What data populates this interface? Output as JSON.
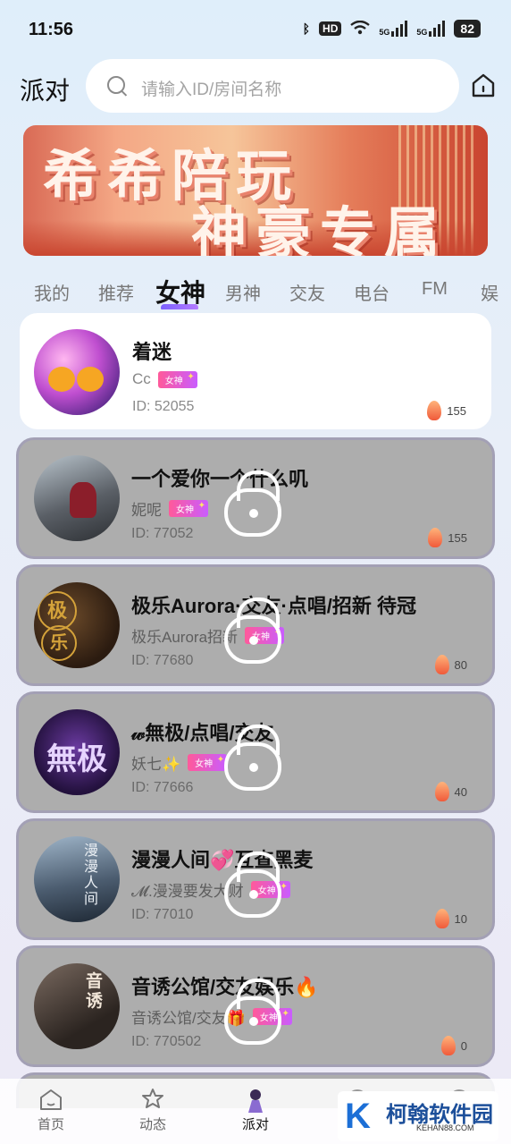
{
  "status": {
    "time": "11:56",
    "hd": "HD",
    "net1": "5G",
    "net2": "5G",
    "battery": "82"
  },
  "header": {
    "title": "派对",
    "search_placeholder": "请输入ID/房间名称"
  },
  "banner": {
    "line1": "希希陪玩",
    "line2": "神豪专属"
  },
  "tabs": [
    "我的",
    "推荐",
    "女神",
    "男神",
    "交友",
    "电台",
    "FM",
    "娱"
  ],
  "active_tab": "女神",
  "rooms": [
    {
      "name": "着迷",
      "host": "Cc",
      "badge": "女神",
      "id": "ID: 52055",
      "heat": "155",
      "locked": false
    },
    {
      "name": "一个爱你一个什么叽",
      "host": "妮呢",
      "badge": "女神",
      "id": "ID: 77052",
      "heat": "155",
      "locked": true
    },
    {
      "name": "极乐Aurora·交友·点唱/招新 待冠",
      "host": "极乐Aurora招新",
      "badge": "女神",
      "id": "ID: 77680",
      "heat": "80",
      "locked": true
    },
    {
      "name": "𝓌無极/点唱/交友",
      "host": "妖七✨",
      "badge": "女神",
      "id": "ID: 77666",
      "heat": "40",
      "locked": true
    },
    {
      "name": "漫漫人间💞互查黑麦",
      "host": "𝓜.漫漫要发大财",
      "badge": "女神",
      "id": "ID: 77010",
      "heat": "10",
      "locked": true
    },
    {
      "name": "音诱公馆/交友娱乐🔥",
      "host": "音诱公馆/交友🎁",
      "badge": "女神",
      "id": "ID: 770502",
      "heat": "0",
      "locked": true
    }
  ],
  "nav": [
    {
      "label": "首页",
      "icon": "home-icon"
    },
    {
      "label": "动态",
      "icon": "moments-icon"
    },
    {
      "label": "派对",
      "icon": "party-icon"
    }
  ],
  "watermark": {
    "cn": "柯翰软件园",
    "en": "KEHAN88.COM"
  }
}
